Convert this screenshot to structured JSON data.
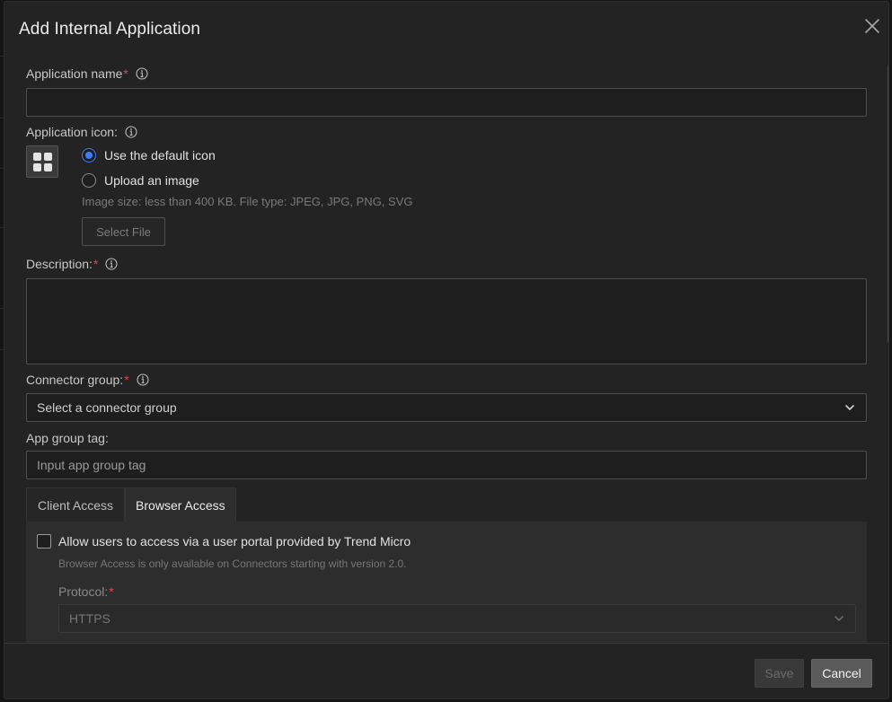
{
  "dialog": {
    "title": "Add Internal Application"
  },
  "form": {
    "app_name": {
      "label": "Application name",
      "required_mark": "*",
      "value": ""
    },
    "app_icon": {
      "label": "Application icon:",
      "options": [
        {
          "label": "Use the default icon",
          "checked": true
        },
        {
          "label": "Upload an image",
          "checked": false
        }
      ],
      "hint": "Image size: less than 400 KB. File type: JPEG, JPG, PNG, SVG",
      "select_file_label": "Select File"
    },
    "description": {
      "label": "Description:",
      "required_mark": "*",
      "value": ""
    },
    "connector_group": {
      "label": "Connector group:",
      "required_mark": "*",
      "placeholder": "Select a connector group"
    },
    "app_group_tag": {
      "label": "App group tag:",
      "placeholder": "Input app group tag"
    },
    "tabs": [
      {
        "label": "Client Access",
        "active": false
      },
      {
        "label": "Browser Access",
        "active": true
      }
    ],
    "browser_access": {
      "checkbox_label": "Allow users to access via a user portal provided by Trend Micro",
      "checked": false,
      "hint": "Browser Access is only available on Connectors starting with version 2.0.",
      "protocol_label": "Protocol:",
      "required_mark": "*",
      "protocol_value": "HTTPS"
    }
  },
  "footer": {
    "save_label": "Save",
    "cancel_label": "Cancel"
  },
  "colors": {
    "accent": "#3d7bff",
    "required": "#e0464c",
    "background": "#232323"
  }
}
